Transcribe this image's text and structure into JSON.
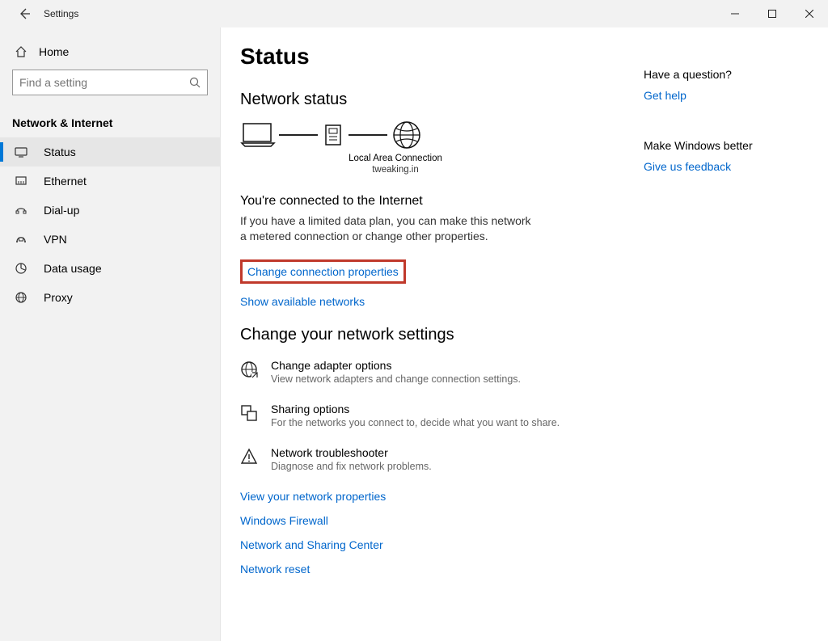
{
  "titlebar": {
    "app_title": "Settings"
  },
  "sidebar": {
    "home_label": "Home",
    "search_placeholder": "Find a setting",
    "category": "Network & Internet",
    "items": [
      {
        "label": "Status"
      },
      {
        "label": "Ethernet"
      },
      {
        "label": "Dial-up"
      },
      {
        "label": "VPN"
      },
      {
        "label": "Data usage"
      },
      {
        "label": "Proxy"
      }
    ]
  },
  "main": {
    "page_title": "Status",
    "network_status_heading": "Network status",
    "connection_name": "Local Area Connection",
    "connection_domain": "tweaking.in",
    "connected_heading": "You're connected to the Internet",
    "connected_body": "If you have a limited data plan, you can make this network a metered connection or change other properties.",
    "change_conn_props": "Change connection properties",
    "show_networks": "Show available networks",
    "change_settings_heading": "Change your network settings",
    "options": [
      {
        "title": "Change adapter options",
        "desc": "View network adapters and change connection settings."
      },
      {
        "title": "Sharing options",
        "desc": "For the networks you connect to, decide what you want to share."
      },
      {
        "title": "Network troubleshooter",
        "desc": "Diagnose and fix network problems."
      }
    ],
    "links": [
      "View your network properties",
      "Windows Firewall",
      "Network and Sharing Center",
      "Network reset"
    ]
  },
  "right": {
    "question_heading": "Have a question?",
    "get_help": "Get help",
    "improve_heading": "Make Windows better",
    "feedback": "Give us feedback"
  }
}
